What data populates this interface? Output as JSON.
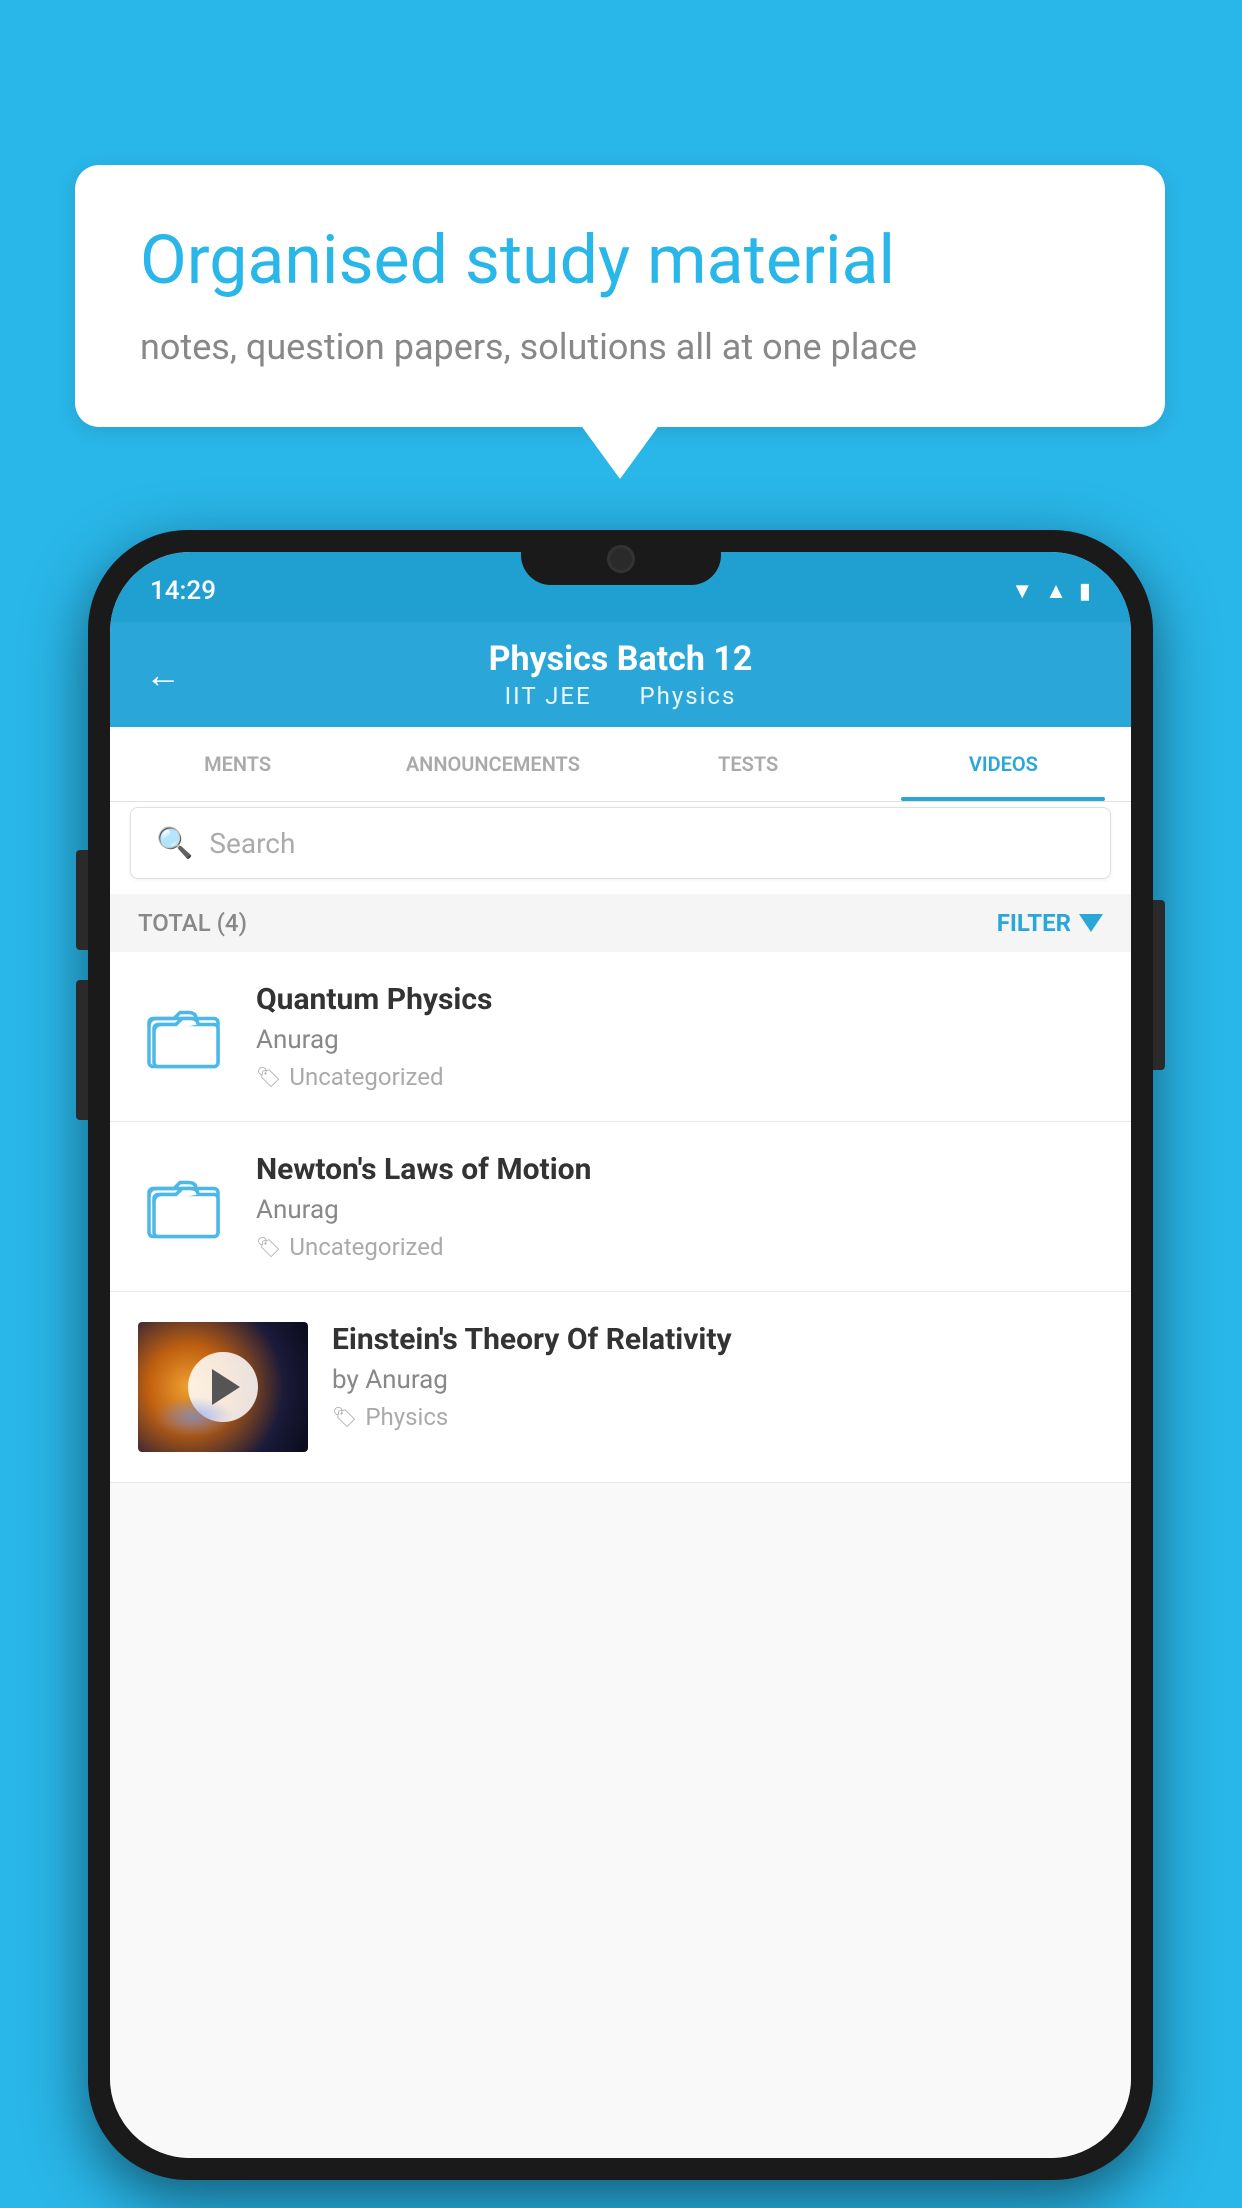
{
  "bubble": {
    "title": "Organised study material",
    "subtitle": "notes, question papers, solutions all at one place"
  },
  "phone": {
    "statusBar": {
      "time": "14:29"
    },
    "header": {
      "backArrow": "←",
      "title": "Physics Batch 12",
      "subtitle1": "IIT JEE",
      "subtitle2": "Physics"
    },
    "tabs": [
      {
        "label": "MENTS",
        "active": false
      },
      {
        "label": "ANNOUNCEMENTS",
        "active": false
      },
      {
        "label": "TESTS",
        "active": false
      },
      {
        "label": "VIDEOS",
        "active": true
      }
    ],
    "search": {
      "placeholder": "Search"
    },
    "filterBar": {
      "total": "TOTAL (4)",
      "filterLabel": "FILTER"
    },
    "videoItems": [
      {
        "title": "Quantum Physics",
        "author": "Anurag",
        "tag": "Uncategorized",
        "hasThumb": false
      },
      {
        "title": "Newton's Laws of Motion",
        "author": "Anurag",
        "tag": "Uncategorized",
        "hasThumb": false
      },
      {
        "title": "Einstein's Theory Of Relativity",
        "author": "by Anurag",
        "tag": "Physics",
        "hasThumb": true
      }
    ]
  }
}
